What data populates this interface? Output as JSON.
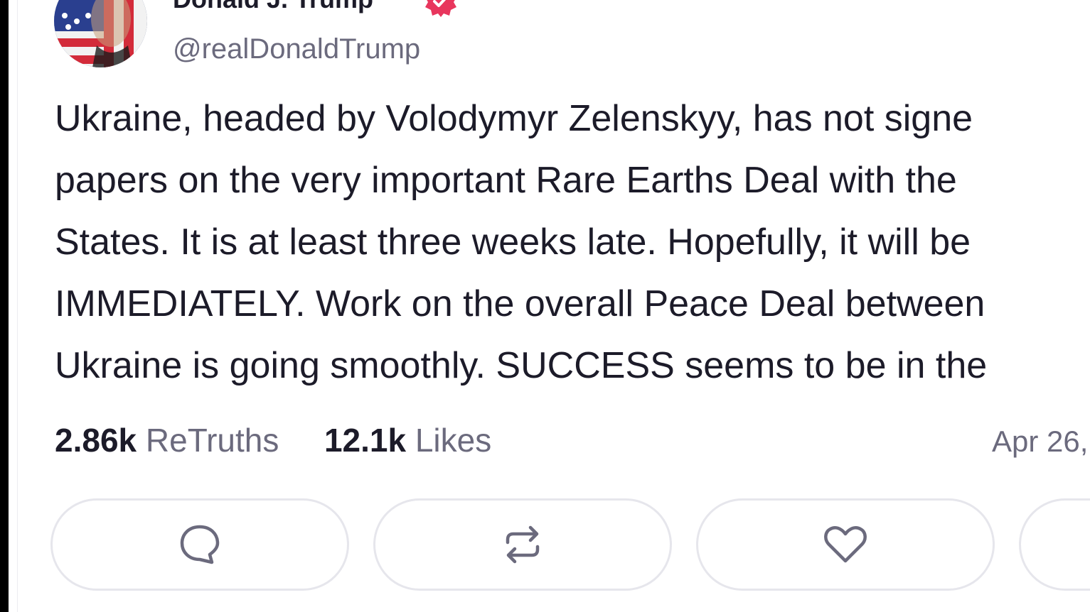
{
  "post": {
    "author_name": "Donald J. Trump",
    "handle": "@realDonaldTrump",
    "verified_icon": "verified-badge-icon",
    "text_lines": [
      "Ukraine, headed by Volodymyr Zelenskyy, has not signe",
      "papers on the very important Rare Earths Deal with the",
      "States. It is at least three weeks late. Hopefully, it will be",
      "IMMEDIATELY. Work on the overall Peace Deal between",
      "Ukraine is going smoothly. SUCCESS seems to be in the"
    ],
    "stats": {
      "retruths_count": "2.86k",
      "retruths_label": "ReTruths",
      "likes_count": "12.1k",
      "likes_label": "Likes"
    },
    "date": "Apr 26,"
  },
  "actions": [
    {
      "icon": "reply-icon"
    },
    {
      "icon": "retruth-icon"
    },
    {
      "icon": "heart-icon"
    },
    {
      "icon": "more-icon"
    }
  ],
  "colors": {
    "text": "#1c1b29",
    "muted": "#6b6a7d",
    "verified": "#e8365d",
    "border": "#e6e6ec"
  }
}
